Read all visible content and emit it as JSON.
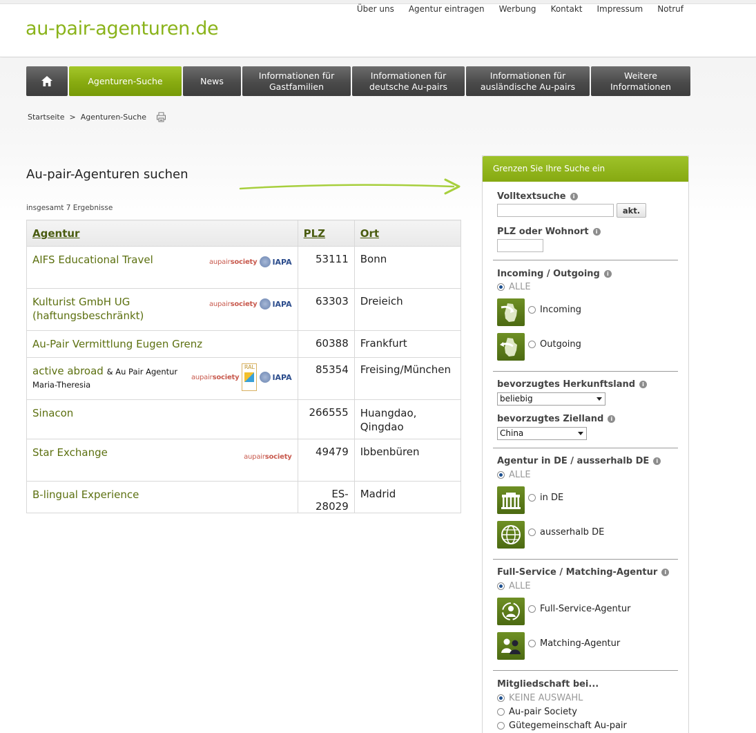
{
  "site": {
    "logo": "au-pair-agenturen.de",
    "top_nav": [
      "Über uns",
      "Agentur eintragen",
      "Werbung",
      "Kontakt",
      "Impressum",
      "Notruf"
    ]
  },
  "main_nav": {
    "home_icon": "home-icon",
    "search": "Agenturen-Suche",
    "news": "News",
    "gast_l1": "Informationen für",
    "gast_l2": "Gastfamilien",
    "de_l1": "Informationen für",
    "de_l2": "deutsche Au-pairs",
    "aus_l1": "Informationen für",
    "aus_l2": "ausländische Au-pairs",
    "weitere_l1": "Weitere",
    "weitere_l2": "Informationen"
  },
  "breadcrumb": {
    "home": "Startseite",
    "sep": ">",
    "current": "Agenturen-Suche"
  },
  "page": {
    "title": "Au-pair-Agenturen suchen",
    "result_count": "insgesamt 7 Ergebnisse"
  },
  "table": {
    "headers": {
      "agency": "Agentur",
      "zip": "PLZ",
      "city": "Ort"
    },
    "rows": [
      {
        "name": "AIFS Educational Travel",
        "zip": "53111",
        "city": "Bonn"
      },
      {
        "name_l1": "Kulturist GmbH UG",
        "name_l2": "(haftungsbeschränkt)",
        "zip": "63303",
        "city": "Dreieich"
      },
      {
        "name": "Au-Pair Vermittlung Eugen Grenz",
        "zip": "60388",
        "city": "Frankfurt"
      },
      {
        "name": "active abroad",
        "sub_a": "& Au Pair Agentur",
        "sub_b": "Maria-Theresia",
        "zip": "85354",
        "city": "Freising/München"
      },
      {
        "name": "Sinacon",
        "zip": "266555",
        "city_l1": "Huangdao,",
        "city_l2": "Qingdao"
      },
      {
        "name": "Star Exchange",
        "zip": "49479",
        "city": "Ibbenbüren"
      },
      {
        "name": "B-lingual Experience",
        "zip": "ES-28029",
        "city": "Madrid"
      }
    ],
    "badges": {
      "aupair_a": "aupair",
      "aupair_b": "society",
      "iapa": "IAPA",
      "ral": "RAL"
    }
  },
  "filter": {
    "heading": "Grenzen Sie Ihre Suche ein",
    "fulltext_label": "Volltextsuche",
    "fulltext_value": "",
    "refresh": "akt.",
    "zip_label": "PLZ oder Wohnort",
    "zip_value": "",
    "inout_label": "Incoming / Outgoing",
    "inout_all": "ALLE",
    "incoming": "Incoming",
    "outgoing": "Outgoing",
    "origin_label": "bevorzugtes Herkunftsland",
    "origin_value": "beliebig",
    "target_label": "bevorzugtes Zielland",
    "target_value": "China",
    "loc_label": "Agentur in DE / ausserhalb DE",
    "loc_all": "ALLE",
    "in_de": "in DE",
    "out_de": "ausserhalb DE",
    "svc_label": "Full-Service / Matching-Agentur",
    "svc_all": "ALLE",
    "full": "Full-Service-Agentur",
    "matching": "Matching-Agentur",
    "member_label": "Mitgliedschaft bei...",
    "member_none": "KEINE AUSWAHL",
    "member_aps": "Au-pair Society",
    "member_gg": "Gütegemeinschaft Au-pair",
    "info_glyph": "i"
  }
}
